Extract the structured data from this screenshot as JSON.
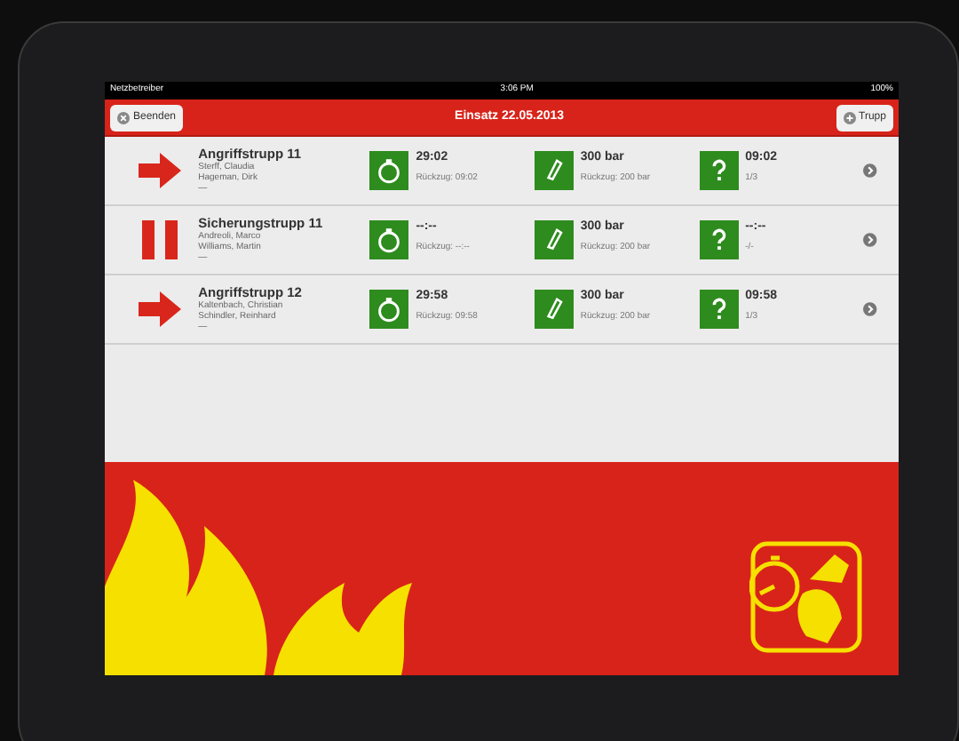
{
  "status_bar": {
    "carrier": "Netzbetreiber",
    "time": "3:06 PM",
    "battery": "100%"
  },
  "nav_bar": {
    "left_button": "Beenden",
    "title": "Einsatz 22.05.2013",
    "right_button": "Trupp"
  },
  "teams": [
    {
      "kind": "arrow",
      "name": "Angriffstrupp 11",
      "members": [
        "Sterff, Claudia",
        "Hageman, Dirk",
        "—"
      ],
      "timer": "29:02",
      "timer_sub": "Rückzug: 09:02",
      "pressure": "300 bar",
      "pressure_sub": "Rückzug: 200 bar",
      "check": "09:02",
      "check_sub": "1/3"
    },
    {
      "kind": "pause",
      "name": "Sicherungstrupp 11",
      "members": [
        "Andreoli, Marco",
        "Williams, Martin",
        "—"
      ],
      "timer": "--:--",
      "timer_sub": "Rückzug: --:--",
      "pressure": "300 bar",
      "pressure_sub": "Rückzug: 200 bar",
      "check": "--:--",
      "check_sub": "-/-"
    },
    {
      "kind": "arrow",
      "name": "Angriffstrupp 12",
      "members": [
        "Kaltenbach, Christian",
        "Schindler, Reinhard",
        "—"
      ],
      "timer": "29:58",
      "timer_sub": "Rückzug: 09:58",
      "pressure": "300 bar",
      "pressure_sub": "Rückzug: 200 bar",
      "check": "09:58",
      "check_sub": "1/3"
    }
  ]
}
